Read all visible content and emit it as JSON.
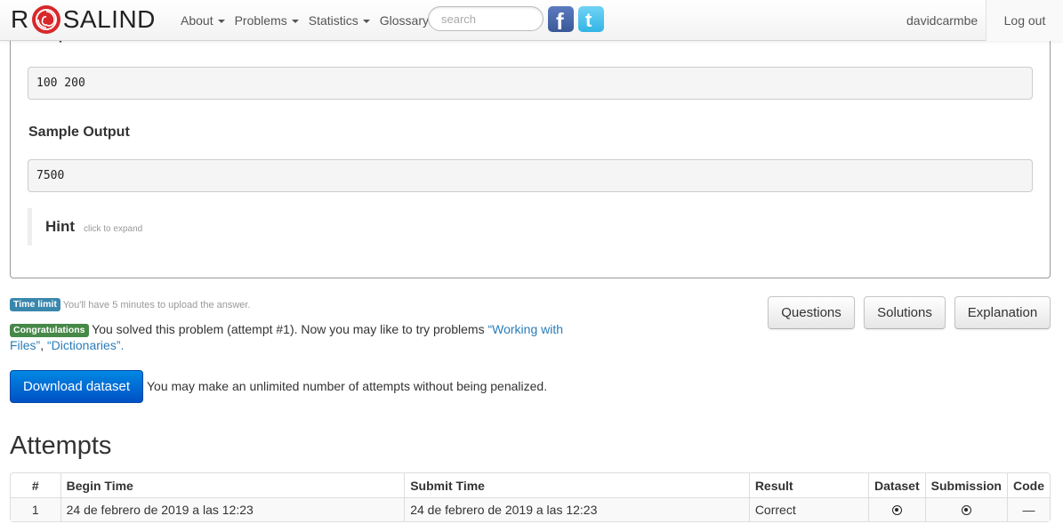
{
  "nav": {
    "brand_left": "R",
    "brand_right": "SALIND",
    "menu": [
      {
        "label": "About",
        "dropdown": true
      },
      {
        "label": "Problems",
        "dropdown": true
      },
      {
        "label": "Statistics",
        "dropdown": true
      },
      {
        "label": "Glossary",
        "dropdown": false
      }
    ],
    "search_placeholder": "search",
    "user": "davidcarmbe",
    "logout": "Log out"
  },
  "panel": {
    "sample_dataset_title": "Sample Dataset",
    "sample_dataset": "100 200",
    "sample_output_title": "Sample Output",
    "sample_output": "7500",
    "hint_title": "Hint",
    "hint_sub": "click to expand"
  },
  "time_limit": {
    "badge": "Time limit",
    "text": "You'll have 5 minutes to upload the answer."
  },
  "congrats": {
    "badge": "Congratulations",
    "text": "You solved this problem (attempt #1). Now you may like to try problems",
    "link1": "“Working with Files”",
    "sep": ",",
    "link2": "“Dictionaries”",
    "end": "."
  },
  "buttons": {
    "questions": "Questions",
    "solutions": "Solutions",
    "explanation": "Explanation",
    "download": "Download dataset"
  },
  "unlimited_text": "You may make an unlimited number of attempts without being penalized.",
  "attempts": {
    "title": "Attempts",
    "headers": [
      "#",
      "Begin Time",
      "Submit Time",
      "Result",
      "Dataset",
      "Submission",
      "Code"
    ],
    "rows": [
      {
        "num": "1",
        "begin": "24 de febrero de 2019 a las 12:23",
        "submit": "24 de febrero de 2019 a las 12:23",
        "result": "Correct",
        "code": "—"
      }
    ]
  }
}
